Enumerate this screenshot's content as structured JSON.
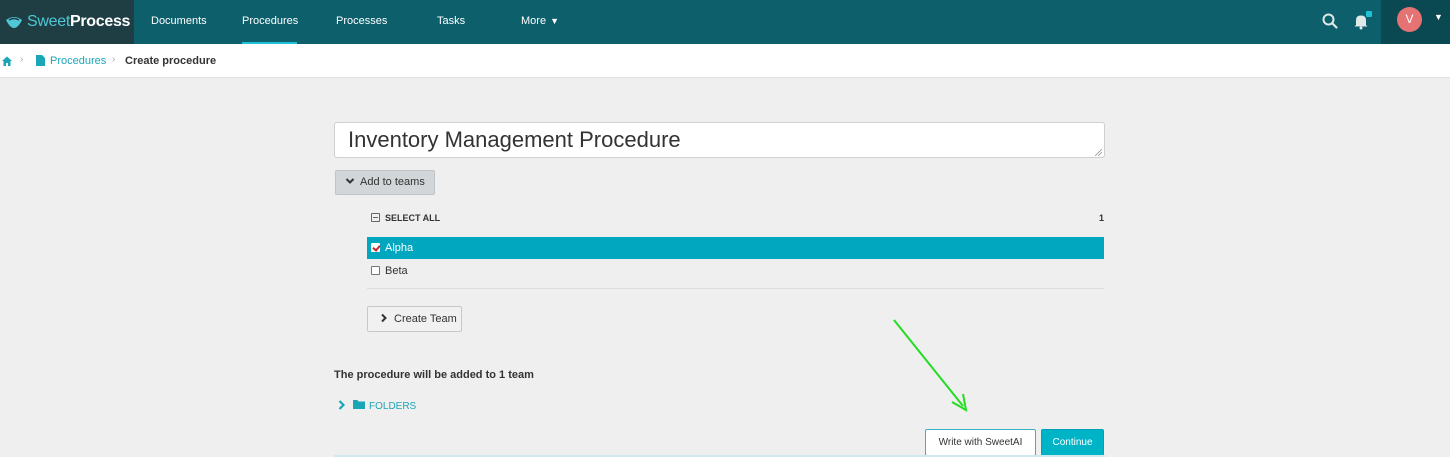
{
  "app": {
    "logo_part1": "Sweet",
    "logo_part2": "Process",
    "brand_color": "#0d5f6b",
    "accent_color": "#00a7bf"
  },
  "nav": {
    "items": [
      {
        "label": "Documents",
        "active": false
      },
      {
        "label": "Procedures",
        "active": true
      },
      {
        "label": "Processes",
        "active": false
      },
      {
        "label": "Tasks",
        "active": false
      },
      {
        "label": "More",
        "active": false,
        "icon": "chevron-down-icon"
      }
    ],
    "search_icon": "search-icon",
    "notifications_icon": "bell-icon",
    "avatar_initial": "V"
  },
  "breadcrumb": {
    "home_icon": "home-icon",
    "link_label": "Procedures",
    "current": "Create procedure"
  },
  "form": {
    "title_value": "Inventory Management Procedure",
    "add_to_teams_label": "Add to teams",
    "select_all_label": "SELECT ALL",
    "selected_count": "1",
    "teams": [
      {
        "name": "Alpha",
        "checked": true
      },
      {
        "name": "Beta",
        "checked": false
      }
    ],
    "create_team_label": "Create Team",
    "team_note": "The procedure will be added to 1 team",
    "folders_label": "FOLDERS",
    "write_ai_label": "Write with SweetAI",
    "continue_label": "Continue"
  },
  "annotation": {
    "arrow_color": "#22dd22"
  }
}
